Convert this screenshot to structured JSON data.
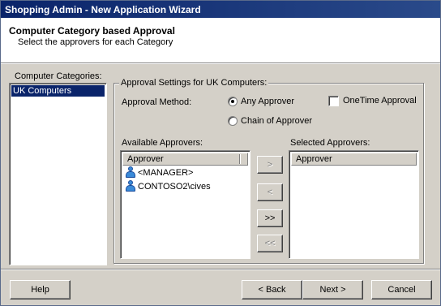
{
  "window": {
    "title": "Shopping Admin - New Application Wizard"
  },
  "header": {
    "title": "Computer Category based Approval",
    "subtitle": "Select the approvers for each Category"
  },
  "categories": {
    "label": "Computer Categories:",
    "items": [
      "UK Computers"
    ],
    "selected": "UK Computers"
  },
  "approval_settings": {
    "legend": "Approval Settings for UK Computers:",
    "method_label": "Approval Method:",
    "options": {
      "any_approver": "Any Approver",
      "chain_of_approver": "Chain  of Approver"
    },
    "selected_method": "Any Approver",
    "onetime_label": "OneTime Approval",
    "onetime_checked": false
  },
  "available_approvers": {
    "label": "Available Approvers:",
    "column": "Approver",
    "rows": [
      "<MANAGER>",
      "CONTOSO2\\cives"
    ]
  },
  "selected_approvers": {
    "label": "Selected Approvers:",
    "column": "Approver",
    "rows": []
  },
  "move_buttons": {
    "add": ">",
    "remove": "<",
    "add_all": ">>",
    "remove_all": "<<"
  },
  "footer": {
    "help": "Help",
    "back": "< Back",
    "next": "Next >",
    "cancel": "Cancel"
  },
  "icons": {
    "approver_icon": "user-icon"
  }
}
